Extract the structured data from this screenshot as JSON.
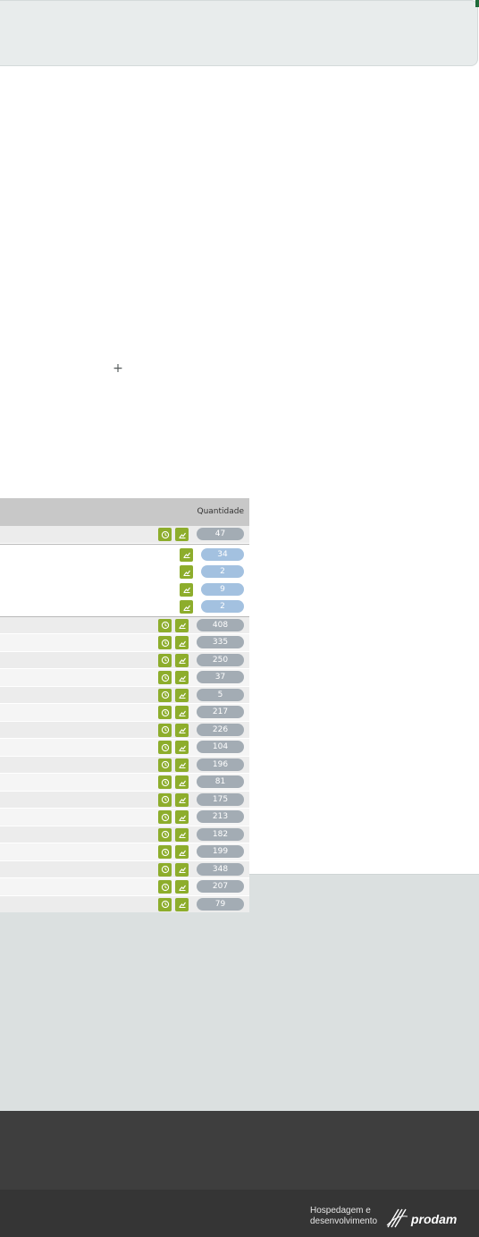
{
  "table": {
    "header": {
      "quantity": "Quantidade"
    },
    "first_row": {
      "value": "47"
    },
    "sub_rows": [
      "34",
      "2",
      "9",
      "2"
    ],
    "rows": [
      "408",
      "335",
      "250",
      "37",
      "5",
      "217",
      "226",
      "104",
      "196",
      "81",
      "175",
      "213",
      "182",
      "199",
      "348",
      "207",
      "79"
    ]
  },
  "footer": {
    "hosting_line1": "Hospedagem e",
    "hosting_line2": "desenvolvimento",
    "logo_text": "prodam"
  },
  "colors": {
    "green_button": "#8dad2c",
    "pill_gray": "#a3acb4",
    "pill_blue": "#a3c1e0",
    "footer_dark": "#3e3e3e"
  },
  "icons": {
    "history": "clock-icon",
    "chart": "trend-icon",
    "add": "plus-icon"
  }
}
